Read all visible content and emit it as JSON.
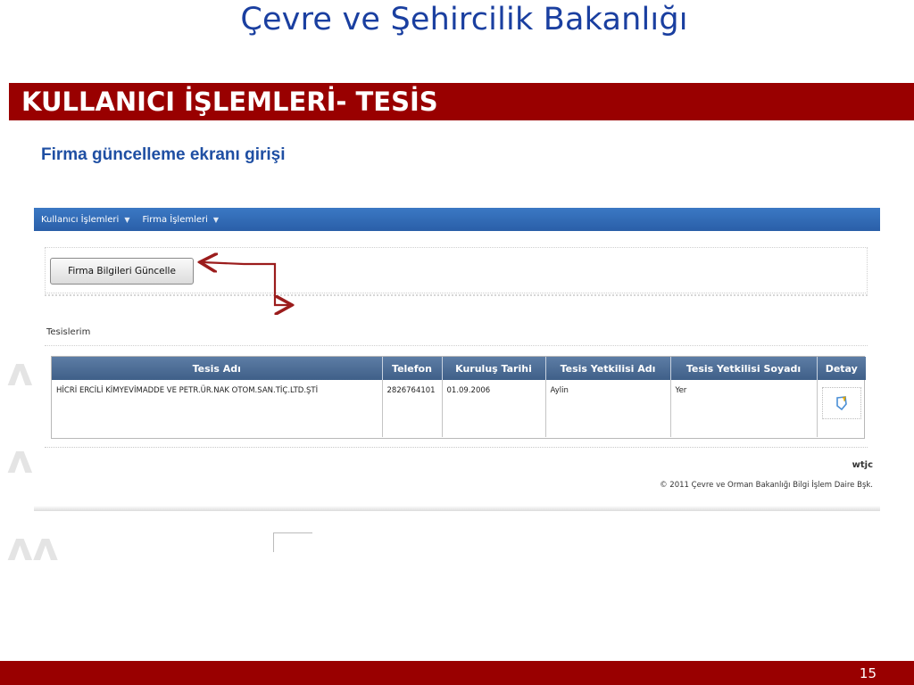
{
  "slide": {
    "title": "Çevre ve Şehircilik Bakanlığı",
    "section": "KULLANICI İŞLEMLERİ- TESİS",
    "subtitle": "Firma güncelleme ekranı girişi",
    "page_number": "15"
  },
  "colors": {
    "title_blue": "#1a3fa0",
    "bar_red": "#990000",
    "menubar_blue": "#2a5fa8",
    "grid_header": "#4a6a94"
  },
  "app": {
    "menu": [
      {
        "label": "Kullanıcı İşlemleri",
        "icon": "chevron-down-icon"
      },
      {
        "label": "Firma İşlemleri",
        "icon": "chevron-down-icon"
      }
    ],
    "update_button": "Firma Bilgileri Güncelle",
    "section_label": "Tesislerim",
    "table": {
      "columns": [
        "Tesis Adı",
        "Telefon",
        "Kuruluş Tarihi",
        "Tesis Yetkilisi Adı",
        "Tesis Yetkilisi Soyadı",
        "Detay"
      ],
      "rows": [
        {
          "tesis_adi": "HİCRİ ERCİLİ KİMYEVİMADDE VE PETR.ÜR.NAK OTOM.SAN.TİÇ.LTD.ŞTİ",
          "telefon": "2826764101",
          "kurulus_tarihi": "01.09.2006",
          "yetkili_adi": "Aylin",
          "yetkili_soyadi": "Yer",
          "detay_icon": "edit-detail-icon"
        }
      ]
    },
    "brand": "wtjc",
    "copyright": "© 2011 Çevre ve Orman Bakanlığı Bilgi İşlem Daire Bşk."
  }
}
